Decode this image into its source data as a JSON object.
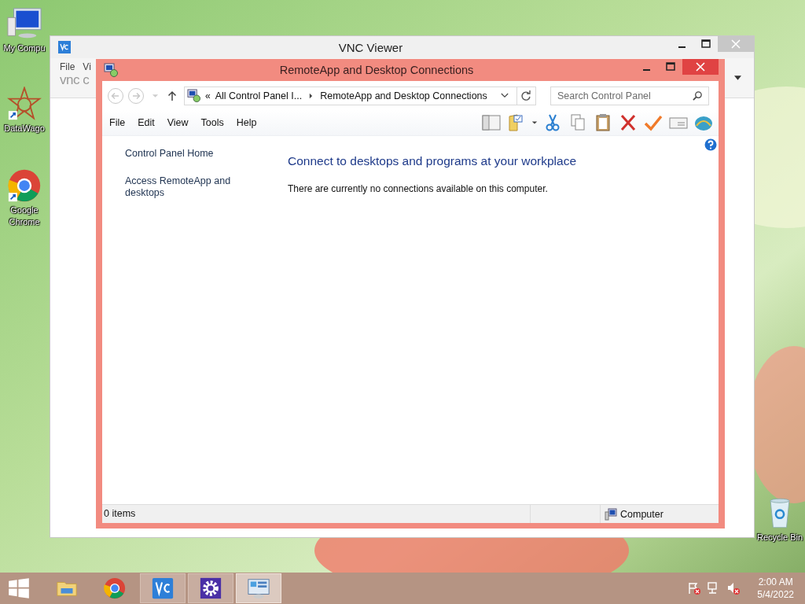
{
  "desktop_icons": [
    {
      "label": "My Compu",
      "kind": "computer"
    },
    {
      "label": "DataWago",
      "kind": "star"
    },
    {
      "label": "Google Chrome",
      "kind": "chrome"
    },
    {
      "label": "Recycle Bin",
      "kind": "bin"
    }
  ],
  "vnc_window": {
    "title": "VNC Viewer",
    "menu": [
      "File",
      "Vi"
    ],
    "logo": "vnc c"
  },
  "window": {
    "title": "RemoteApp and Desktop Connections",
    "address": {
      "prefix": "«",
      "parts": [
        "All Control Panel I...",
        "RemoteApp and Desktop Connections"
      ]
    },
    "search": {
      "placeholder": "Search Control Panel"
    },
    "menu": [
      "File",
      "Edit",
      "View",
      "Tools",
      "Help"
    ],
    "sidebar": [
      "Control Panel Home",
      "Access RemoteApp and desktops"
    ],
    "heading": "Connect to desktops and programs at your workplace",
    "message": "There are currently no connections available on this computer.",
    "status_bar": {
      "items": "0 items",
      "location": "Computer"
    }
  },
  "taskbar": {
    "apps": [
      {
        "kind": "explorer",
        "running": false,
        "selected": false
      },
      {
        "kind": "chrome",
        "running": false,
        "selected": false
      },
      {
        "kind": "vnc",
        "running": true,
        "selected": false
      },
      {
        "kind": "settings",
        "running": true,
        "selected": false
      },
      {
        "kind": "control",
        "running": true,
        "selected": true
      }
    ],
    "time": "2:00 AM",
    "date": "5/4/2022"
  }
}
